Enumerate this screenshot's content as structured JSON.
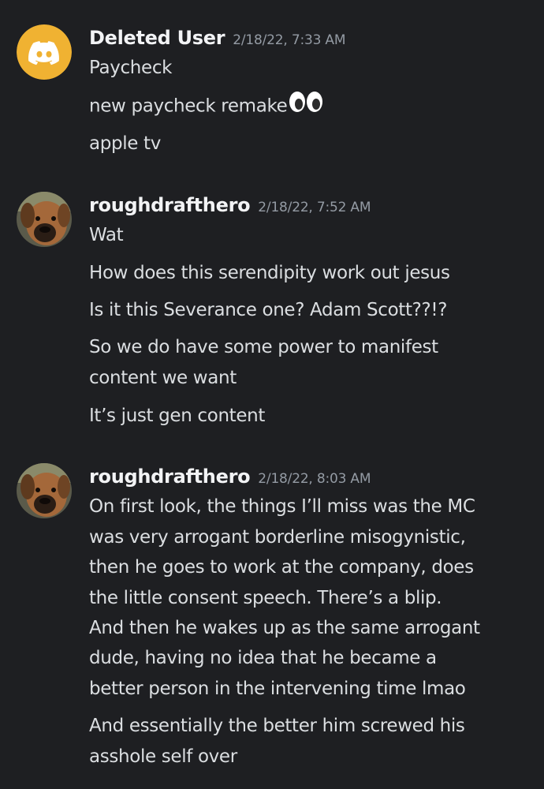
{
  "messages": [
    {
      "username": "Deleted User",
      "timestamp": "2/18/22, 7:33 AM",
      "avatar_icon": "discord-logo-icon",
      "lines": [
        "Paycheck",
        "new paycheck remake",
        "apple tv"
      ],
      "emoji": "eyes-emoji"
    },
    {
      "username": "roughdrafthero",
      "timestamp": "2/18/22, 7:52 AM",
      "avatar_icon": "dog-avatar",
      "lines": [
        "Wat",
        "How does this serendipity work out jesus",
        "Is it this Severance one? Adam Scott??!?",
        "So we do have some power to manifest",
        "content we want",
        "It’s just gen content"
      ]
    },
    {
      "username": "roughdrafthero",
      "timestamp": "2/18/22, 8:03 AM",
      "avatar_icon": "dog-avatar",
      "lines": [
        "On first look, the things I’ll miss was the MC",
        "was very arrogant borderline misogynistic,",
        "then he goes to work at the company, does",
        "the little consent speech. There’s a blip.",
        "And then he wakes up as the same arrogant",
        "dude, having no idea that he became a",
        "better person in the intervening time lmao",
        "And essentially the better him screwed his",
        "asshole self over"
      ]
    }
  ],
  "colors": {
    "background": "#1e1f22",
    "username": "#f2f3f5",
    "timestamp": "#949ba4",
    "text": "#dbdee1",
    "discord_avatar": "#f0b232"
  }
}
